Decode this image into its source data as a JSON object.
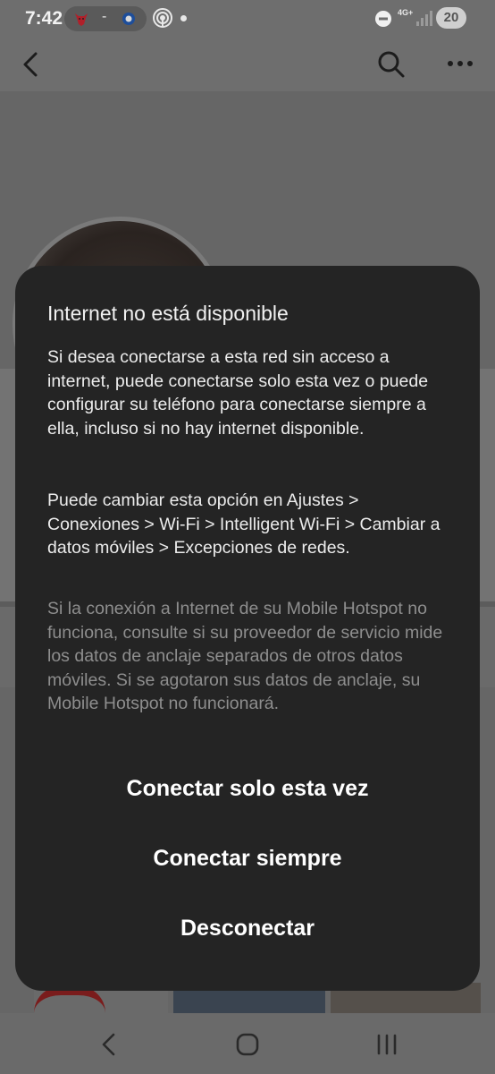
{
  "status_bar": {
    "time": "7:42",
    "notification_separator": "-",
    "network_type": "4G+",
    "battery": "20",
    "icons": [
      "bulls-logo-icon",
      "team-logo-icon",
      "hotspot-icon",
      "dot-icon",
      "do-not-disturb-icon",
      "signal-icon"
    ]
  },
  "app_bar": {
    "icons": [
      "back-arrow-icon",
      "search-icon",
      "more-options-icon"
    ]
  },
  "dialog": {
    "title": "Internet no está disponible",
    "paragraph_1": "Si desea conectarse a esta red sin acceso a internet, puede conectarse solo esta vez o puede configurar su teléfono para conectarse siempre a ella, incluso si no hay internet disponible.",
    "paragraph_2": "Puede cambiar esta opción en Ajustes > Conexiones > Wi-Fi > Intelligent Wi-Fi > Cambiar a datos móviles > Excepciones de redes.",
    "paragraph_3": "Si la conexión a Internet de su Mobile Hotspot no funciona, consulte si su proveedor de servicio mide los datos de anclaje separados de otros datos móviles. Si se agotaron sus datos de anclaje, su Mobile Hotspot no funcionará.",
    "buttons": {
      "connect_once": "Conectar solo esta vez",
      "connect_always": "Conectar siempre",
      "disconnect": "Desconectar"
    }
  },
  "nav_bar": {
    "icons": [
      "nav-back-icon",
      "nav-home-icon",
      "nav-recent-apps-icon"
    ]
  },
  "colors": {
    "dialog_background": "#242424",
    "scrim": "#666666",
    "secondary_text": "#8e8e8e"
  }
}
